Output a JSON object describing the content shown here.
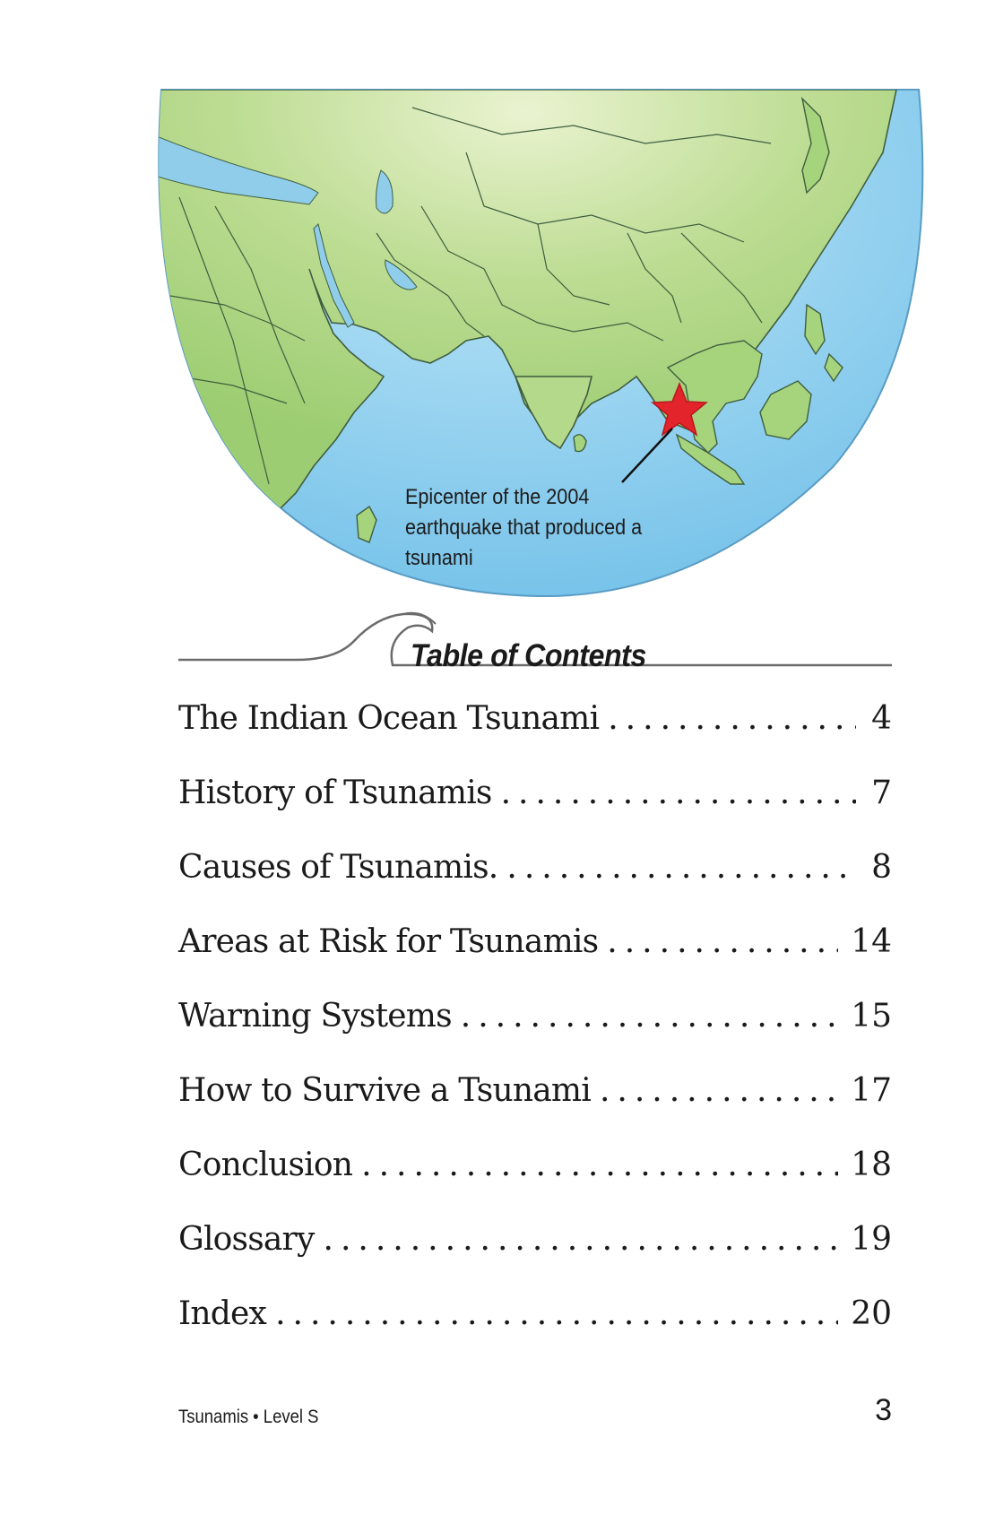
{
  "figure": {
    "caption": "Epicenter of the 2004 earthquake that produced a tsunami",
    "marker_icon": "star-icon",
    "colors": {
      "ocean": "#7cc6ea",
      "land": "#a6d47c",
      "border": "#3f5e3f",
      "marker": "#e3242b"
    }
  },
  "toc": {
    "title": "Table of Contents",
    "items": [
      {
        "label": "The Indian Ocean Tsunami",
        "page": "4"
      },
      {
        "label": "History of Tsunamis",
        "page": "7"
      },
      {
        "label": "Causes of Tsunamis.",
        "page": "8"
      },
      {
        "label": "Areas at Risk for Tsunamis",
        "page": "14"
      },
      {
        "label": "Warning Systems",
        "page": "15"
      },
      {
        "label": "How to Survive a Tsunami",
        "page": "17"
      },
      {
        "label": "Conclusion",
        "page": "18"
      },
      {
        "label": "Glossary",
        "page": "19"
      },
      {
        "label": "Index",
        "page": "20"
      }
    ]
  },
  "footer": {
    "book": "Tsunamis • Level S",
    "page_number": "3"
  }
}
